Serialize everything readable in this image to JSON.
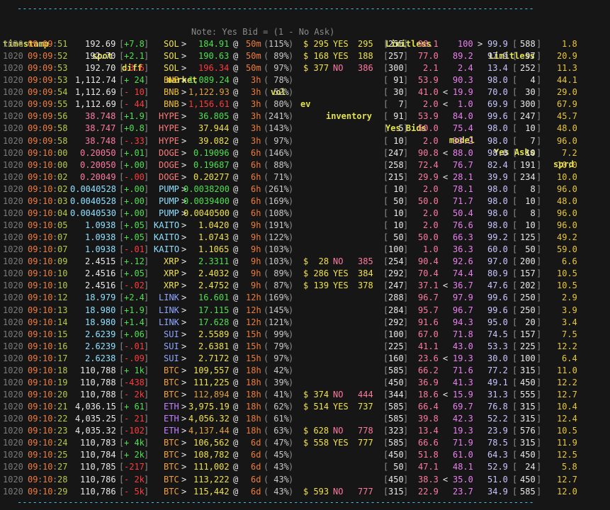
{
  "header": {
    "note": "Note: Yes Bid = (1 - No Ask)",
    "limitless_left": "Limitless",
    "limitless_right": "Limitless",
    "cols": {
      "timestamp": "timestamp",
      "spot": "spot",
      "diff": "diff",
      "market": "market",
      "vol": "vol",
      "ev": "ev",
      "inventory": "inventory",
      "yes_bids": "Yes Bids",
      "model": "model",
      "yes_asks": "Yes Asks",
      "sprd": "sprd"
    }
  },
  "rule": "-----------------------------------------------------------------------------------------------------",
  "rows": [
    {
      "date": "1020",
      "hh": "09",
      "mm": "09",
      "ss": "51",
      "spot": "192.69",
      "diff": "+7.8",
      "asset": "SOL",
      "mkt": "184.91",
      "mkt_color": "green",
      "tte": "50m",
      "vol": "115%",
      "ev": "$ 295",
      "side": "YES",
      "inv": "295",
      "bidq": "255",
      "bid": "98.1",
      "cmp1": " ",
      "model": "100",
      "cmp2": ">",
      "ask": "99.9",
      "askq": "588",
      "sprd": "1.8"
    },
    {
      "date": "1020",
      "hh": "09",
      "mm": "09",
      "ss": "52",
      "spot": "192.70",
      "diff": "+2.1",
      "asset": "SOL",
      "mkt": "190.63",
      "mkt_color": "green",
      "tte": "50m",
      "vol": " 89%",
      "ev": "$ 168",
      "side": "YES",
      "inv": "188",
      "bidq": "257",
      "bid": "77.0",
      "cmp1": " ",
      "model": "89.2",
      "cmp2": " ",
      "ask": "97.9",
      "askq": " 97",
      "sprd": "20.9"
    },
    {
      "date": "1020",
      "hh": "09",
      "mm": "09",
      "ss": "53",
      "spot": "192.70",
      "diff": "-3.6",
      "asset": "SOL",
      "mkt": "196.34",
      "mkt_color": "red",
      "tte": "50m",
      "vol": " 97%",
      "ev": "$ 377",
      "side": "NO",
      "inv": "386",
      "bidq": "300",
      "bid": "2.1",
      "cmp1": " ",
      "model": "2.4",
      "cmp2": " ",
      "ask": "13.4",
      "askq": "252",
      "sprd": "11.3"
    },
    {
      "date": "1020",
      "hh": "09",
      "mm": "09",
      "ss": "53",
      "spot": "1,112.74",
      "diff": "+ 24",
      "asset": "BNB",
      "mkt": "1,089.24",
      "mkt_color": "green",
      "tte": "3h",
      "vol": " 78%",
      "ev": "",
      "side": "",
      "inv": "",
      "bidq": " 91",
      "bid": "53.9",
      "cmp1": " ",
      "model": "90.3",
      "cmp2": " ",
      "ask": "98.0",
      "askq": "  4",
      "sprd": "44.1"
    },
    {
      "date": "1020",
      "hh": "09",
      "mm": "09",
      "ss": "54",
      "spot": "1,112.69",
      "diff": "- 10",
      "asset": "BNB",
      "mkt": "1,122.93",
      "mkt_color": "orange",
      "tte": "3h",
      "vol": " 52%",
      "ev": "",
      "side": "",
      "inv": "",
      "bidq": " 30",
      "bid": "41.0",
      "cmp1": "<",
      "model": "19.9",
      "cmp2": " ",
      "ask": "70.0",
      "askq": " 30",
      "sprd": "29.0"
    },
    {
      "date": "1020",
      "hh": "09",
      "mm": "09",
      "ss": "55",
      "spot": "1,112.69",
      "diff": "- 44",
      "asset": "BNB",
      "mkt": "1,156.61",
      "mkt_color": "red",
      "tte": "3h",
      "vol": " 80%",
      "ev": "",
      "side": "",
      "inv": "",
      "bidq": "  7",
      "bid": "2.0",
      "cmp1": "<",
      "model": "1.0",
      "cmp2": " ",
      "ask": "69.9",
      "askq": "300",
      "sprd": "67.9"
    },
    {
      "date": "1020",
      "hh": "09",
      "mm": "09",
      "ss": "56",
      "spot": "38.748",
      "diff": "+1.9",
      "asset": "HYPE",
      "mkt": "36.805",
      "mkt_color": "green",
      "tte": "3h",
      "vol": "241%",
      "ev": "",
      "side": "",
      "inv": "",
      "bidq": " 91",
      "bid": "53.9",
      "cmp1": " ",
      "model": "84.0",
      "cmp2": " ",
      "ask": "99.6",
      "askq": "247",
      "sprd": "45.7"
    },
    {
      "date": "1020",
      "hh": "09",
      "mm": "09",
      "ss": "58",
      "spot": "38.747",
      "diff": "+0.8",
      "asset": "HYPE",
      "mkt": "37.944",
      "mkt_color": "yellow",
      "tte": "3h",
      "vol": "143%",
      "ev": "",
      "side": "",
      "inv": "",
      "bidq": "  5",
      "bid": "50.0",
      "cmp1": " ",
      "model": "75.4",
      "cmp2": " ",
      "ask": "98.0",
      "askq": " 10",
      "sprd": "48.0"
    },
    {
      "date": "1020",
      "hh": "09",
      "mm": "09",
      "ss": "58",
      "spot": "38.748",
      "diff": "-.33",
      "asset": "HYPE",
      "mkt": "39.082",
      "mkt_color": "yellow",
      "tte": "3h",
      "vol": " 97%",
      "ev": "",
      "side": "",
      "inv": "",
      "bidq": " 10",
      "bid": "2.0",
      "cmp1": " ",
      "model": "33.2",
      "cmp2": " ",
      "ask": "98.0",
      "askq": "  7",
      "sprd": "96.0"
    },
    {
      "date": "1020",
      "hh": "09",
      "mm": "10",
      "ss": "00",
      "spot": "0.20050",
      "diff": "+.01",
      "asset": "DOGE",
      "mkt": "0.19096",
      "mkt_color": "green",
      "tte": "6h",
      "vol": "146%",
      "ev": "",
      "side": "",
      "inv": "",
      "bidq": "247",
      "bid": "90.8",
      "cmp1": "<",
      "model": "88.0",
      "cmp2": " ",
      "ask": "98.0",
      "askq": " 10",
      "sprd": "7.2"
    },
    {
      "date": "1020",
      "hh": "09",
      "mm": "10",
      "ss": "00",
      "spot": "0.20050",
      "diff": "+.00",
      "asset": "DOGE",
      "mkt": "0.19687",
      "mkt_color": "green",
      "tte": "6h",
      "vol": " 88%",
      "ev": "",
      "side": "",
      "inv": "",
      "bidq": "258",
      "bid": "72.4",
      "cmp1": " ",
      "model": "76.7",
      "cmp2": " ",
      "ask": "82.4",
      "askq": "191",
      "sprd": "10.0"
    },
    {
      "date": "1020",
      "hh": "09",
      "mm": "10",
      "ss": "02",
      "spot": "0.20049",
      "diff": "-.00",
      "asset": "DOGE",
      "mkt": "0.20277",
      "mkt_color": "yellow",
      "tte": "6h",
      "vol": " 71%",
      "ev": "",
      "side": "",
      "inv": "",
      "bidq": "215",
      "bid": "29.9",
      "cmp1": "<",
      "model": "28.1",
      "cmp2": " ",
      "ask": "39.9",
      "askq": "234",
      "sprd": "10.0"
    },
    {
      "date": "1020",
      "hh": "09",
      "mm": "10",
      "ss": "02",
      "spot": "0.0040528",
      "diff": "+.00",
      "asset": "PUMP",
      "mkt": "0.0038200",
      "mkt_color": "green",
      "tte": "6h",
      "vol": "261%",
      "ev": "",
      "side": "",
      "inv": "",
      "bidq": " 10",
      "bid": "2.0",
      "cmp1": " ",
      "model": "78.1",
      "cmp2": " ",
      "ask": "98.0",
      "askq": "  8",
      "sprd": "96.0"
    },
    {
      "date": "1020",
      "hh": "09",
      "mm": "10",
      "ss": "03",
      "spot": "0.0040528",
      "diff": "+.00",
      "asset": "PUMP",
      "mkt": "0.0039400",
      "mkt_color": "green",
      "tte": "6h",
      "vol": "169%",
      "ev": "",
      "side": "",
      "inv": "",
      "bidq": " 50",
      "bid": "50.0",
      "cmp1": " ",
      "model": "71.7",
      "cmp2": " ",
      "ask": "98.0",
      "askq": " 10",
      "sprd": "48.0"
    },
    {
      "date": "1020",
      "hh": "09",
      "mm": "10",
      "ss": "04",
      "spot": "0.0040530",
      "diff": "+.00",
      "asset": "PUMP",
      "mkt": "0.0040500",
      "mkt_color": "yellow",
      "tte": "6h",
      "vol": "108%",
      "ev": "",
      "side": "",
      "inv": "",
      "bidq": " 10",
      "bid": "2.0",
      "cmp1": " ",
      "model": "50.4",
      "cmp2": " ",
      "ask": "98.0",
      "askq": "  8",
      "sprd": "96.0"
    },
    {
      "date": "1020",
      "hh": "09",
      "mm": "10",
      "ss": "05",
      "spot": "1.0938",
      "diff": "+.05",
      "asset": "KAITO",
      "mkt": "1.0420",
      "mkt_color": "yellow",
      "tte": "9h",
      "vol": "191%",
      "ev": "",
      "side": "",
      "inv": "",
      "bidq": " 10",
      "bid": "2.0",
      "cmp1": " ",
      "model": "76.6",
      "cmp2": " ",
      "ask": "98.0",
      "askq": " 10",
      "sprd": "96.0"
    },
    {
      "date": "1020",
      "hh": "09",
      "mm": "10",
      "ss": "07",
      "spot": "1.0938",
      "diff": "+.05",
      "asset": "KAITO",
      "mkt": "1.0743",
      "mkt_color": "yellow",
      "tte": "9h",
      "vol": "122%",
      "ev": "",
      "side": "",
      "inv": "",
      "bidq": " 50",
      "bid": "50.0",
      "cmp1": " ",
      "model": "66.3",
      "cmp2": " ",
      "ask": "99.2",
      "askq": "125",
      "sprd": "49.2"
    },
    {
      "date": "1020",
      "hh": "09",
      "mm": "10",
      "ss": "07",
      "spot": "1.0938",
      "diff": "-.01",
      "asset": "KAITO",
      "mkt": "1.1065",
      "mkt_color": "yellow",
      "tte": "9h",
      "vol": "103%",
      "ev": "",
      "side": "",
      "inv": "",
      "bidq": "100",
      "bid": "1.0",
      "cmp1": " ",
      "model": "36.3",
      "cmp2": " ",
      "ask": "60.0",
      "askq": " 50",
      "sprd": "59.0"
    },
    {
      "date": "1020",
      "hh": "09",
      "mm": "10",
      "ss": "09",
      "spot": "2.4515",
      "diff": "+.12",
      "asset": "XRP",
      "mkt": "2.3311",
      "mkt_color": "green",
      "tte": "9h",
      "vol": "103%",
      "ev": "$  28",
      "side": "NO",
      "inv": "385",
      "bidq": "254",
      "bid": "90.4",
      "cmp1": " ",
      "model": "92.6",
      "cmp2": " ",
      "ask": "97.0",
      "askq": "200",
      "sprd": "6.6"
    },
    {
      "date": "1020",
      "hh": "09",
      "mm": "10",
      "ss": "10",
      "spot": "2.4516",
      "diff": "+.05",
      "asset": "XRP",
      "mkt": "2.4032",
      "mkt_color": "yellow",
      "tte": "9h",
      "vol": " 89%",
      "ev": "$ 286",
      "side": "YES",
      "inv": "384",
      "bidq": "292",
      "bid": "70.4",
      "cmp1": " ",
      "model": "74.4",
      "cmp2": " ",
      "ask": "80.9",
      "askq": "157",
      "sprd": "10.5"
    },
    {
      "date": "1020",
      "hh": "09",
      "mm": "10",
      "ss": "10",
      "spot": "2.4516",
      "diff": "-.02",
      "asset": "XRP",
      "mkt": "2.4752",
      "mkt_color": "yellow",
      "tte": "9h",
      "vol": " 87%",
      "ev": "$ 139",
      "side": "YES",
      "inv": "378",
      "bidq": "247",
      "bid": "37.1",
      "cmp1": "<",
      "model": "36.7",
      "cmp2": " ",
      "ask": "47.6",
      "askq": "202",
      "sprd": "10.5"
    },
    {
      "date": "1020",
      "hh": "09",
      "mm": "10",
      "ss": "12",
      "spot": "18.979",
      "diff": "+2.4",
      "asset": "LINK",
      "mkt": "16.601",
      "mkt_color": "green",
      "tte": "12h",
      "vol": "169%",
      "ev": "",
      "side": "",
      "inv": "",
      "bidq": "288",
      "bid": "96.7",
      "cmp1": " ",
      "model": "97.9",
      "cmp2": " ",
      "ask": "99.6",
      "askq": "250",
      "sprd": "2.9"
    },
    {
      "date": "1020",
      "hh": "09",
      "mm": "10",
      "ss": "13",
      "spot": "18.980",
      "diff": "+1.9",
      "asset": "LINK",
      "mkt": "17.115",
      "mkt_color": "green",
      "tte": "12h",
      "vol": "145%",
      "ev": "",
      "side": "",
      "inv": "",
      "bidq": "284",
      "bid": "95.7",
      "cmp1": " ",
      "model": "96.7",
      "cmp2": " ",
      "ask": "99.6",
      "askq": "250",
      "sprd": "3.9"
    },
    {
      "date": "1020",
      "hh": "09",
      "mm": "10",
      "ss": "14",
      "spot": "18.980",
      "diff": "+1.4",
      "asset": "LINK",
      "mkt": "17.628",
      "mkt_color": "green",
      "tte": "12h",
      "vol": "121%",
      "ev": "",
      "side": "",
      "inv": "",
      "bidq": "292",
      "bid": "91.6",
      "cmp1": " ",
      "model": "94.3",
      "cmp2": " ",
      "ask": "95.0",
      "askq": " 20",
      "sprd": "3.4"
    },
    {
      "date": "1020",
      "hh": "09",
      "mm": "10",
      "ss": "15",
      "spot": "2.6239",
      "diff": "+.06",
      "asset": "SUI",
      "mkt": "2.5589",
      "mkt_color": "yellow",
      "tte": "15h",
      "vol": " 99%",
      "ev": "",
      "side": "",
      "inv": "",
      "bidq": "100",
      "bid": "67.0",
      "cmp1": " ",
      "model": "71.8",
      "cmp2": " ",
      "ask": "74.5",
      "askq": "157",
      "sprd": "7.5"
    },
    {
      "date": "1020",
      "hh": "09",
      "mm": "10",
      "ss": "16",
      "spot": "2.6239",
      "diff": "-.01",
      "asset": "SUI",
      "mkt": "2.6381",
      "mkt_color": "yellow",
      "tte": "15h",
      "vol": " 79%",
      "ev": "",
      "side": "",
      "inv": "",
      "bidq": "225",
      "bid": "41.1",
      "cmp1": " ",
      "model": "43.0",
      "cmp2": " ",
      "ask": "53.3",
      "askq": "225",
      "sprd": "12.2"
    },
    {
      "date": "1020",
      "hh": "09",
      "mm": "10",
      "ss": "17",
      "spot": "2.6238",
      "diff": "-.09",
      "asset": "SUI",
      "mkt": "2.7172",
      "mkt_color": "yellow",
      "tte": "15h",
      "vol": " 97%",
      "ev": "",
      "side": "",
      "inv": "",
      "bidq": "160",
      "bid": "23.6",
      "cmp1": "<",
      "model": "19.3",
      "cmp2": " ",
      "ask": "30.0",
      "askq": "100",
      "sprd": "6.4"
    },
    {
      "date": "1020",
      "hh": "09",
      "mm": "10",
      "ss": "18",
      "spot": "110,788",
      "diff": "+ 1k",
      "asset": "BTC",
      "mkt": "109,557",
      "mkt_color": "yellow",
      "tte": "18h",
      "vol": " 42%",
      "ev": "",
      "side": "",
      "inv": "",
      "bidq": "585",
      "bid": "66.2",
      "cmp1": " ",
      "model": "71.6",
      "cmp2": " ",
      "ask": "77.2",
      "askq": "315",
      "sprd": "11.0"
    },
    {
      "date": "1020",
      "hh": "09",
      "mm": "10",
      "ss": "19",
      "spot": "110,788",
      "diff": "-438",
      "asset": "BTC",
      "mkt": "111,225",
      "mkt_color": "yellow",
      "tte": "18h",
      "vol": " 39%",
      "ev": "",
      "side": "",
      "inv": "",
      "bidq": "450",
      "bid": "36.9",
      "cmp1": " ",
      "model": "41.3",
      "cmp2": " ",
      "ask": "49.1",
      "askq": "450",
      "sprd": "12.2"
    },
    {
      "date": "1020",
      "hh": "09",
      "mm": "10",
      "ss": "20",
      "spot": "110,788",
      "diff": "- 2k",
      "asset": "BTC",
      "mkt": "112,894",
      "mkt_color": "orange",
      "tte": "18h",
      "vol": " 41%",
      "ev": "$ 374",
      "side": "NO",
      "inv": "444",
      "bidq": "344",
      "bid": "18.6",
      "cmp1": "<",
      "model": "15.9",
      "cmp2": " ",
      "ask": "31.3",
      "askq": "555",
      "sprd": "12.7"
    },
    {
      "date": "1020",
      "hh": "09",
      "mm": "10",
      "ss": "21",
      "spot": "4,036.15",
      "diff": "+ 61",
      "asset": "ETH",
      "mkt": "3,975.19",
      "mkt_color": "yellow",
      "tte": "18h",
      "vol": " 62%",
      "ev": "$ 514",
      "side": "YES",
      "inv": "737",
      "bidq": "585",
      "bid": "66.4",
      "cmp1": " ",
      "model": "69.7",
      "cmp2": " ",
      "ask": "76.8",
      "askq": "315",
      "sprd": "10.4"
    },
    {
      "date": "1020",
      "hh": "09",
      "mm": "10",
      "ss": "22",
      "spot": "4,035.25",
      "diff": "- 21",
      "asset": "ETH",
      "mkt": "4,056.32",
      "mkt_color": "yellow",
      "tte": "18h",
      "vol": " 61%",
      "ev": "",
      "side": "",
      "inv": "",
      "bidq": "585",
      "bid": "39.8",
      "cmp1": " ",
      "model": "42.3",
      "cmp2": " ",
      "ask": "52.2",
      "askq": "315",
      "sprd": "12.4"
    },
    {
      "date": "1020",
      "hh": "09",
      "mm": "10",
      "ss": "23",
      "spot": "4,035.32",
      "diff": "-102",
      "asset": "ETH",
      "mkt": "4,137.44",
      "mkt_color": "orange",
      "tte": "18h",
      "vol": " 63%",
      "ev": "$ 628",
      "side": "NO",
      "inv": "778",
      "bidq": "323",
      "bid": "13.4",
      "cmp1": " ",
      "model": "19.3",
      "cmp2": " ",
      "ask": "23.9",
      "askq": "576",
      "sprd": "10.5"
    },
    {
      "date": "1020",
      "hh": "09",
      "mm": "10",
      "ss": "24",
      "spot": "110,783",
      "diff": "+ 4k",
      "asset": "BTC",
      "mkt": "106,562",
      "mkt_color": "yellow",
      "tte": "6d",
      "vol": " 47%",
      "ev": "$ 558",
      "side": "YES",
      "inv": "777",
      "bidq": "585",
      "bid": "66.6",
      "cmp1": " ",
      "model": "71.9",
      "cmp2": " ",
      "ask": "78.5",
      "askq": "315",
      "sprd": "11.9"
    },
    {
      "date": "1020",
      "hh": "09",
      "mm": "10",
      "ss": "25",
      "spot": "110,784",
      "diff": "+ 2k",
      "asset": "BTC",
      "mkt": "108,782",
      "mkt_color": "yellow",
      "tte": "6d",
      "vol": " 45%",
      "ev": "",
      "side": "",
      "inv": "",
      "bidq": "450",
      "bid": "51.8",
      "cmp1": " ",
      "model": "61.0",
      "cmp2": " ",
      "ask": "64.3",
      "askq": "450",
      "sprd": "12.5"
    },
    {
      "date": "1020",
      "hh": "09",
      "mm": "10",
      "ss": "27",
      "spot": "110,785",
      "diff": "-217",
      "asset": "BTC",
      "mkt": "111,002",
      "mkt_color": "yellow",
      "tte": "6d",
      "vol": " 43%",
      "ev": "",
      "side": "",
      "inv": "",
      "bidq": " 50",
      "bid": "47.1",
      "cmp1": " ",
      "model": "48.1",
      "cmp2": " ",
      "ask": "52.9",
      "askq": " 24",
      "sprd": "5.8"
    },
    {
      "date": "1020",
      "hh": "09",
      "mm": "10",
      "ss": "28",
      "spot": "110,786",
      "diff": "- 2k",
      "asset": "BTC",
      "mkt": "113,222",
      "mkt_color": "yellow",
      "tte": "6d",
      "vol": " 43%",
      "ev": "",
      "side": "",
      "inv": "",
      "bidq": "450",
      "bid": "38.3",
      "cmp1": "<",
      "model": "35.0",
      "cmp2": " ",
      "ask": "51.0",
      "askq": "450",
      "sprd": "12.7"
    },
    {
      "date": "1020",
      "hh": "09",
      "mm": "10",
      "ss": "29",
      "spot": "110,786",
      "diff": "- 5k",
      "asset": "BTC",
      "mkt": "115,442",
      "mkt_color": "yellow",
      "tte": "6d",
      "vol": " 43%",
      "ev": "$ 593",
      "side": "NO",
      "inv": "777",
      "bidq": "315",
      "bid": "22.9",
      "cmp1": " ",
      "model": "23.7",
      "cmp2": " ",
      "ask": "34.9",
      "askq": "585",
      "sprd": "12.0"
    }
  ],
  "colors": {
    "background": "#161616",
    "header": "#e2e24c",
    "rule": "#39c6e6",
    "time": "#f07c3a",
    "green": "#4ee04e",
    "red": "#ff3a3a",
    "model": "#ea80f0",
    "bid": "#ff7aa0",
    "spread": "#e8c83a"
  }
}
